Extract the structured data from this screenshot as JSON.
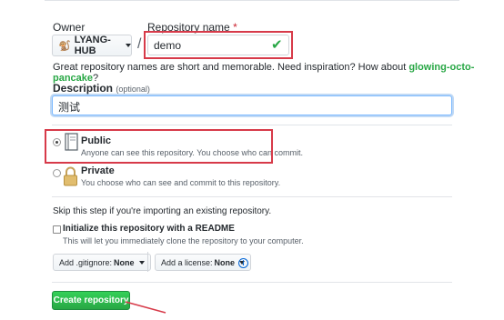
{
  "owner": {
    "label": "Owner",
    "value": "LYANG-HUB"
  },
  "repo_name": {
    "label": "Repository name",
    "required_mark": "*",
    "value": "demo"
  },
  "name_hint": {
    "text": "Great repository names are short and memorable. Need inspiration? How about ",
    "suggestion": "glowing-octo-pancake",
    "end": "?"
  },
  "description": {
    "label": "Description",
    "optional": "(optional)",
    "value": "测试"
  },
  "visibility": {
    "public": {
      "title": "Public",
      "desc": "Anyone can see this repository. You choose who can commit.",
      "selected": true
    },
    "private": {
      "title": "Private",
      "desc": "You choose who can see and commit to this repository.",
      "selected": false
    }
  },
  "import_hint": "Skip this step if you're importing an existing repository.",
  "init_readme": {
    "title": "Initialize this repository with a README",
    "desc": "This will let you immediately clone the repository to your computer.",
    "checked": false
  },
  "gitignore": {
    "label": "Add .gitignore:",
    "value": "None"
  },
  "license": {
    "label": "Add a license:",
    "value": "None"
  },
  "create_button": "Create repository",
  "colors": {
    "accent_green": "#28a745",
    "highlight_red": "#d73a49",
    "focus_blue": "#79b8ff"
  }
}
